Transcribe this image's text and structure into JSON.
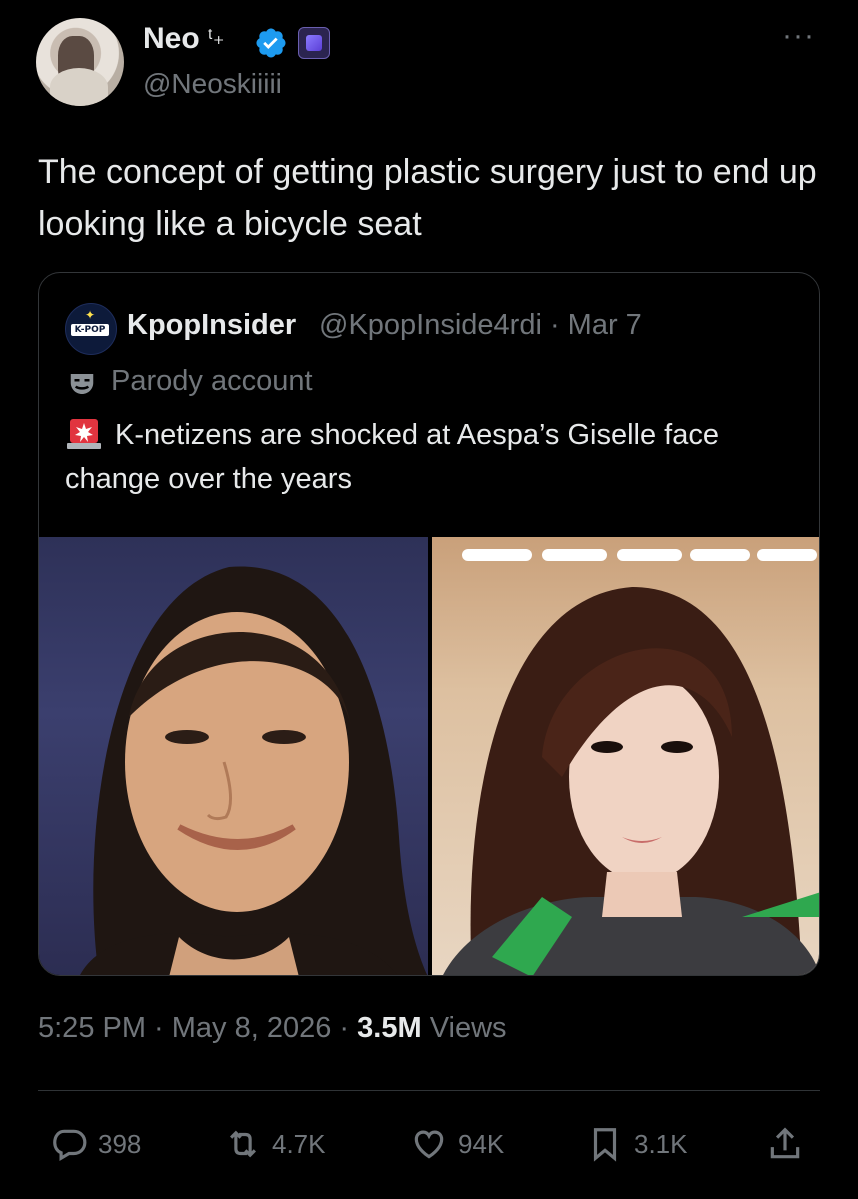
{
  "author": {
    "display_name": "Neo",
    "name_decoration": "ᵗ₊",
    "handle": "@Neoskiiiii"
  },
  "tweet": {
    "text": "The concept of getting plastic surgery just to end up looking like a bicycle seat",
    "timestamp": "5:25 PM · May 8, 2026 · ",
    "views_count": "3.5M",
    "views_label": " Views"
  },
  "quoted_tweet": {
    "avatar_label": "K-POP",
    "display_name": "KpopInsider",
    "meta": "@KpopInside4rdi · Mar 7",
    "parody_label": "Parody account",
    "text": "K-netizens are shocked at Aespa’s Giselle face change over the years"
  },
  "actions": {
    "replies": "398",
    "reposts": "4.7K",
    "likes": "94K",
    "bookmarks": "3.1K"
  },
  "colors": {
    "background": "#000000",
    "text": "#e7e9ea",
    "secondary": "#71767b",
    "verified": "#1d9bf0",
    "border": "#333639"
  }
}
